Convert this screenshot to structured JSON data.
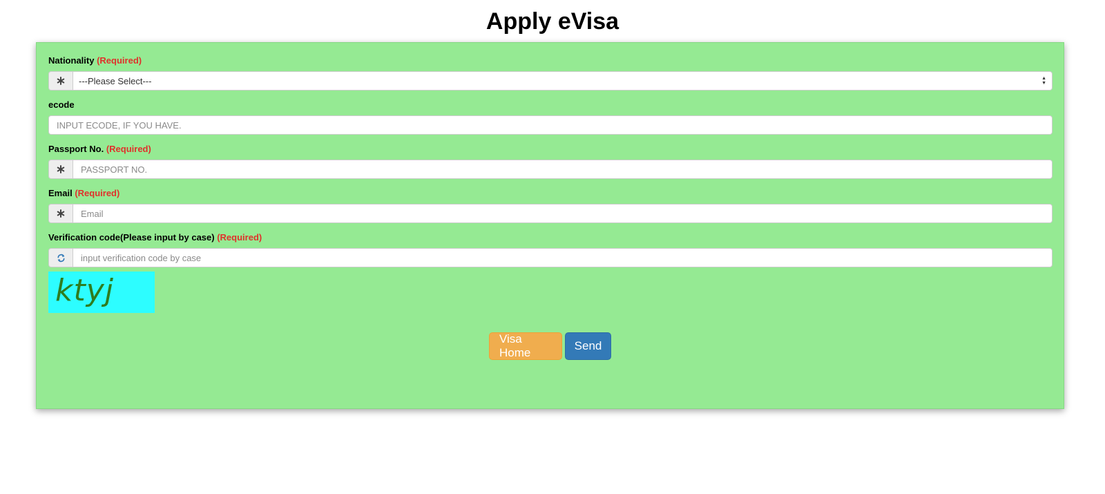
{
  "page": {
    "title": "Apply eVisa"
  },
  "form": {
    "required_tag": "(Required)",
    "nationality": {
      "label": "Nationality",
      "selected": "---Please Select---",
      "icon": "asterisk-icon"
    },
    "ecode": {
      "label": "ecode",
      "placeholder": "INPUT ECODE, IF YOU HAVE."
    },
    "passport": {
      "label": "Passport No.",
      "placeholder": "PASSPORT NO.",
      "icon": "asterisk-icon"
    },
    "email": {
      "label": "Email",
      "placeholder": "Email",
      "icon": "asterisk-icon"
    },
    "verification": {
      "label": "Verification code(Please input by case)",
      "placeholder": "input verification code by case",
      "icon": "refresh-icon",
      "captcha_text": "ktyj"
    }
  },
  "buttons": {
    "home_label": "Visa Home",
    "send_label": "Send"
  },
  "colors": {
    "panel_bg": "#95ea93",
    "required": "#e0312b",
    "home_button": "#f0ad4e",
    "send_button": "#337ab7",
    "captcha_bg": "#2dfdff"
  }
}
